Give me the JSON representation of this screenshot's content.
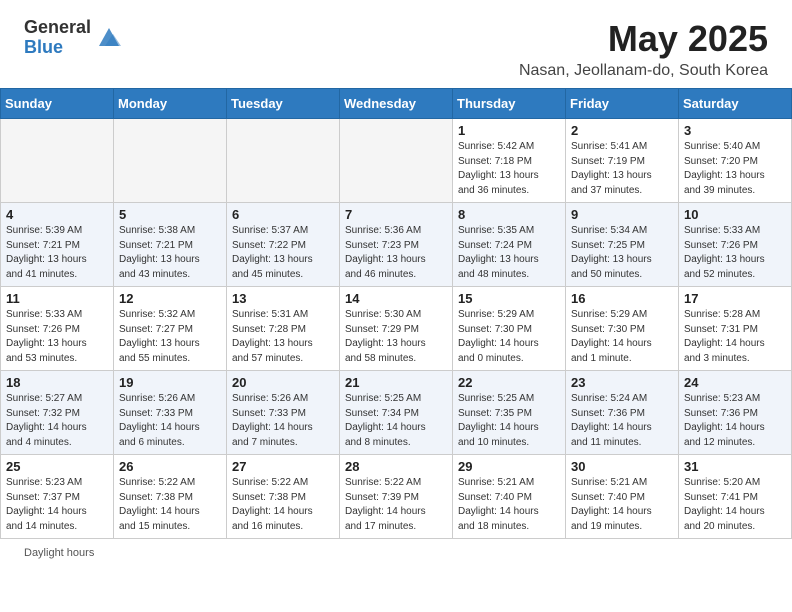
{
  "header": {
    "logo_general": "General",
    "logo_blue": "Blue",
    "month": "May 2025",
    "location": "Nasan, Jeollanam-do, South Korea"
  },
  "weekdays": [
    "Sunday",
    "Monday",
    "Tuesday",
    "Wednesday",
    "Thursday",
    "Friday",
    "Saturday"
  ],
  "weeks": [
    [
      {
        "day": "",
        "info": ""
      },
      {
        "day": "",
        "info": ""
      },
      {
        "day": "",
        "info": ""
      },
      {
        "day": "",
        "info": ""
      },
      {
        "day": "1",
        "info": "Sunrise: 5:42 AM\nSunset: 7:18 PM\nDaylight: 13 hours\nand 36 minutes."
      },
      {
        "day": "2",
        "info": "Sunrise: 5:41 AM\nSunset: 7:19 PM\nDaylight: 13 hours\nand 37 minutes."
      },
      {
        "day": "3",
        "info": "Sunrise: 5:40 AM\nSunset: 7:20 PM\nDaylight: 13 hours\nand 39 minutes."
      }
    ],
    [
      {
        "day": "4",
        "info": "Sunrise: 5:39 AM\nSunset: 7:21 PM\nDaylight: 13 hours\nand 41 minutes."
      },
      {
        "day": "5",
        "info": "Sunrise: 5:38 AM\nSunset: 7:21 PM\nDaylight: 13 hours\nand 43 minutes."
      },
      {
        "day": "6",
        "info": "Sunrise: 5:37 AM\nSunset: 7:22 PM\nDaylight: 13 hours\nand 45 minutes."
      },
      {
        "day": "7",
        "info": "Sunrise: 5:36 AM\nSunset: 7:23 PM\nDaylight: 13 hours\nand 46 minutes."
      },
      {
        "day": "8",
        "info": "Sunrise: 5:35 AM\nSunset: 7:24 PM\nDaylight: 13 hours\nand 48 minutes."
      },
      {
        "day": "9",
        "info": "Sunrise: 5:34 AM\nSunset: 7:25 PM\nDaylight: 13 hours\nand 50 minutes."
      },
      {
        "day": "10",
        "info": "Sunrise: 5:33 AM\nSunset: 7:26 PM\nDaylight: 13 hours\nand 52 minutes."
      }
    ],
    [
      {
        "day": "11",
        "info": "Sunrise: 5:33 AM\nSunset: 7:26 PM\nDaylight: 13 hours\nand 53 minutes."
      },
      {
        "day": "12",
        "info": "Sunrise: 5:32 AM\nSunset: 7:27 PM\nDaylight: 13 hours\nand 55 minutes."
      },
      {
        "day": "13",
        "info": "Sunrise: 5:31 AM\nSunset: 7:28 PM\nDaylight: 13 hours\nand 57 minutes."
      },
      {
        "day": "14",
        "info": "Sunrise: 5:30 AM\nSunset: 7:29 PM\nDaylight: 13 hours\nand 58 minutes."
      },
      {
        "day": "15",
        "info": "Sunrise: 5:29 AM\nSunset: 7:30 PM\nDaylight: 14 hours\nand 0 minutes."
      },
      {
        "day": "16",
        "info": "Sunrise: 5:29 AM\nSunset: 7:30 PM\nDaylight: 14 hours\nand 1 minute."
      },
      {
        "day": "17",
        "info": "Sunrise: 5:28 AM\nSunset: 7:31 PM\nDaylight: 14 hours\nand 3 minutes."
      }
    ],
    [
      {
        "day": "18",
        "info": "Sunrise: 5:27 AM\nSunset: 7:32 PM\nDaylight: 14 hours\nand 4 minutes."
      },
      {
        "day": "19",
        "info": "Sunrise: 5:26 AM\nSunset: 7:33 PM\nDaylight: 14 hours\nand 6 minutes."
      },
      {
        "day": "20",
        "info": "Sunrise: 5:26 AM\nSunset: 7:33 PM\nDaylight: 14 hours\nand 7 minutes."
      },
      {
        "day": "21",
        "info": "Sunrise: 5:25 AM\nSunset: 7:34 PM\nDaylight: 14 hours\nand 8 minutes."
      },
      {
        "day": "22",
        "info": "Sunrise: 5:25 AM\nSunset: 7:35 PM\nDaylight: 14 hours\nand 10 minutes."
      },
      {
        "day": "23",
        "info": "Sunrise: 5:24 AM\nSunset: 7:36 PM\nDaylight: 14 hours\nand 11 minutes."
      },
      {
        "day": "24",
        "info": "Sunrise: 5:23 AM\nSunset: 7:36 PM\nDaylight: 14 hours\nand 12 minutes."
      }
    ],
    [
      {
        "day": "25",
        "info": "Sunrise: 5:23 AM\nSunset: 7:37 PM\nDaylight: 14 hours\nand 14 minutes."
      },
      {
        "day": "26",
        "info": "Sunrise: 5:22 AM\nSunset: 7:38 PM\nDaylight: 14 hours\nand 15 minutes."
      },
      {
        "day": "27",
        "info": "Sunrise: 5:22 AM\nSunset: 7:38 PM\nDaylight: 14 hours\nand 16 minutes."
      },
      {
        "day": "28",
        "info": "Sunrise: 5:22 AM\nSunset: 7:39 PM\nDaylight: 14 hours\nand 17 minutes."
      },
      {
        "day": "29",
        "info": "Sunrise: 5:21 AM\nSunset: 7:40 PM\nDaylight: 14 hours\nand 18 minutes."
      },
      {
        "day": "30",
        "info": "Sunrise: 5:21 AM\nSunset: 7:40 PM\nDaylight: 14 hours\nand 19 minutes."
      },
      {
        "day": "31",
        "info": "Sunrise: 5:20 AM\nSunset: 7:41 PM\nDaylight: 14 hours\nand 20 minutes."
      }
    ]
  ],
  "footer": {
    "daylight_label": "Daylight hours"
  }
}
